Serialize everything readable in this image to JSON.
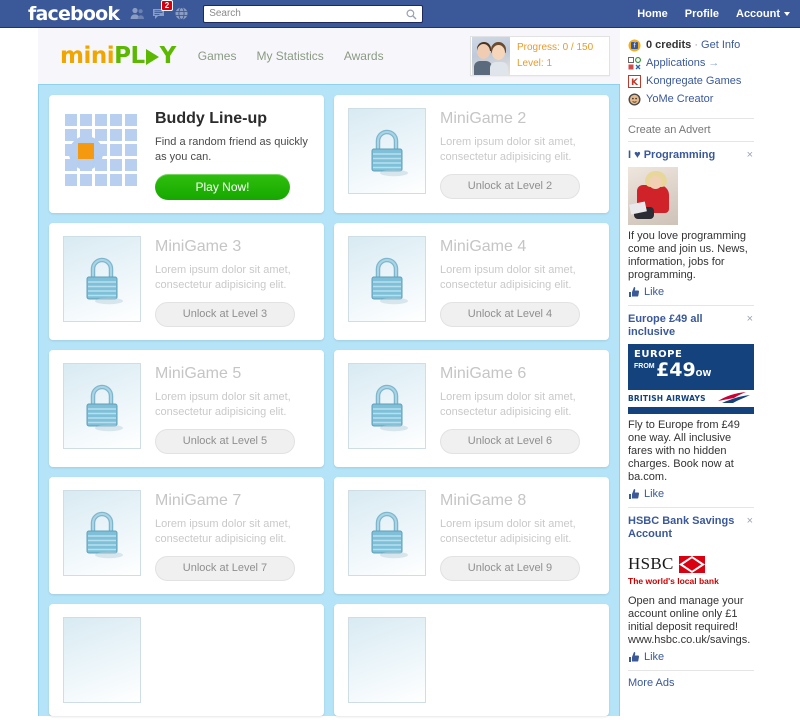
{
  "facebook": {
    "logo": "facebook",
    "icons": [
      {
        "name": "friend-requests-icon",
        "badge": ""
      },
      {
        "name": "messages-icon",
        "badge": "2"
      },
      {
        "name": "notifications-globe-icon",
        "badge": ""
      }
    ],
    "search": {
      "placeholder": "Search",
      "value": ""
    },
    "nav": [
      {
        "label": "Home"
      },
      {
        "label": "Profile"
      },
      {
        "label": "Account",
        "has_caret": true
      }
    ]
  },
  "app": {
    "logo": {
      "part1": "mini",
      "part2": "PL",
      "part3": "Y"
    },
    "nav": [
      {
        "label": "Games"
      },
      {
        "label": "My Statistics"
      },
      {
        "label": "Awards"
      }
    ],
    "progress": {
      "progress_label": "Progress: 0 / 150",
      "level_label": "Level: 1"
    },
    "games": [
      {
        "title": "Buddy Line-up",
        "desc": "Find a random friend as quickly as you can.",
        "button": "Play Now!",
        "locked": false,
        "icon": "buddy-grid-icon"
      },
      {
        "title": "MiniGame 2",
        "desc": "Lorem ipsum dolor sit amet, consectetur adipisicing elit.",
        "button": "Unlock at Level 2",
        "locked": true,
        "icon": "padlock-icon"
      },
      {
        "title": "MiniGame 3",
        "desc": "Lorem ipsum dolor sit amet, consectetur adipisicing elit.",
        "button": "Unlock at Level 3",
        "locked": true,
        "icon": "padlock-icon"
      },
      {
        "title": "MiniGame 4",
        "desc": "Lorem ipsum dolor sit amet, consectetur adipisicing elit.",
        "button": "Unlock at Level 4",
        "locked": true,
        "icon": "padlock-icon"
      },
      {
        "title": "MiniGame 5",
        "desc": "Lorem ipsum dolor sit amet, consectetur adipisicing elit.",
        "button": "Unlock at Level 5",
        "locked": true,
        "icon": "padlock-icon"
      },
      {
        "title": "MiniGame 6",
        "desc": "Lorem ipsum dolor sit amet, consectetur adipisicing elit.",
        "button": "Unlock at Level 6",
        "locked": true,
        "icon": "padlock-icon"
      },
      {
        "title": "MiniGame 7",
        "desc": "Lorem ipsum dolor sit amet, consectetur adipisicing elit.",
        "button": "Unlock at Level 7",
        "locked": true,
        "icon": "padlock-icon"
      },
      {
        "title": "MiniGame 8",
        "desc": "Lorem ipsum dolor sit amet, consectetur adipisicing elit.",
        "button": "Unlock at Level 9",
        "locked": true,
        "icon": "padlock-icon"
      }
    ]
  },
  "sidebar": {
    "links": [
      {
        "name": "credits",
        "bold": "0 credits",
        "sep": "·",
        "link": "Get Info",
        "icon": "credits-icon"
      },
      {
        "name": "applications",
        "bold": "",
        "sep": "",
        "link": "Applications",
        "arrow": "→",
        "icon": "applications-icon"
      },
      {
        "name": "kongregate-games",
        "bold": "",
        "sep": "",
        "link": "Kongregate Games",
        "icon": "kongregate-icon"
      },
      {
        "name": "yome-creator",
        "bold": "",
        "sep": "",
        "link": "YoMe Creator",
        "icon": "yome-icon"
      }
    ],
    "ads_header": "Create an Advert",
    "ads": [
      {
        "title": "I ♥ Programming",
        "text": "If you love programming come and join us. News, information, jobs for programming.",
        "like": "Like",
        "close": "×",
        "art": "programmer-photo"
      },
      {
        "title": "Europe £49 all inclusive",
        "text": "Fly to Europe from £49 one way. All inclusive fares with no hidden charges. Book now at ba.com.",
        "like": "Like",
        "close": "×",
        "art": "british-airways-banner",
        "banner": {
          "europe": "EUROPE",
          "from": "FROM",
          "price": "£49",
          "ow": "OW",
          "airline": "BRITISH AIRWAYS"
        }
      },
      {
        "title": "HSBC Bank Savings Account",
        "text": "Open and manage your account online only £1 initial deposit required! www.hsbc.co.uk/savings.",
        "like": "Like",
        "close": "×",
        "art": "hsbc-logo",
        "banner": {
          "word": "HSBC",
          "tagline": "The world's local bank"
        }
      }
    ],
    "more_ads": "More Ads"
  },
  "colors": {
    "fb_blue": "#3b5998",
    "panel_blue": "#b5e3f7",
    "play_green": "#16a800",
    "logo_orange": "#f0a500",
    "logo_green": "#5cb800",
    "progress_orange": "#e79b2a"
  }
}
